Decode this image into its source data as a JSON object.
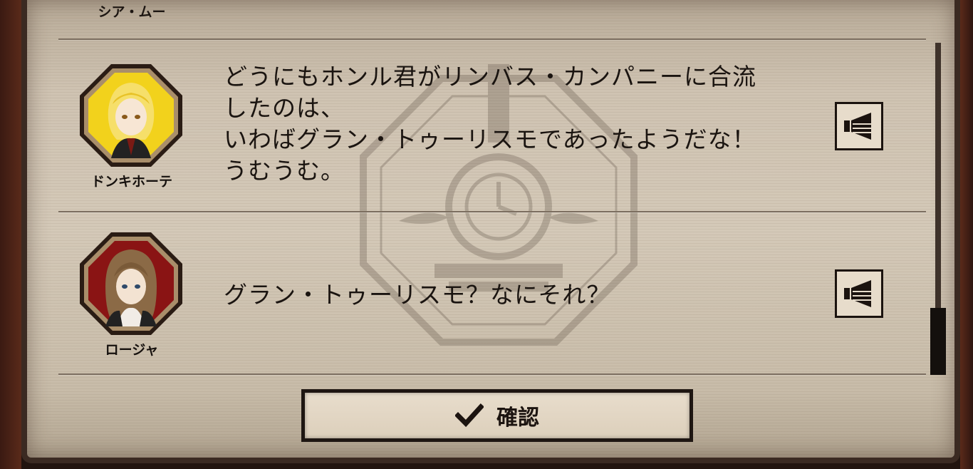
{
  "top_entry": {
    "speaker": "シア・ムー"
  },
  "entries": [
    {
      "speaker": "ドンキホーテ",
      "text": "どうにもホンル君がリンバス・カンパニーに合流\nしたのは、\nいわばグラン・トゥーリスモであったようだな！\nうむうむ。",
      "voice_icon": "speaker-icon"
    },
    {
      "speaker": "ロージャ",
      "text": "グラン・トゥーリスモ？なにそれ？",
      "voice_icon": "speaker-icon"
    }
  ],
  "confirm": {
    "label": "確認",
    "icon": "checkmark-icon"
  },
  "colors": {
    "panel": "#c9bdac",
    "frame": "#3b2a22",
    "text": "#1a1410",
    "portrait_yellow": "#f2d21c",
    "portrait_red": "#8a1414"
  }
}
